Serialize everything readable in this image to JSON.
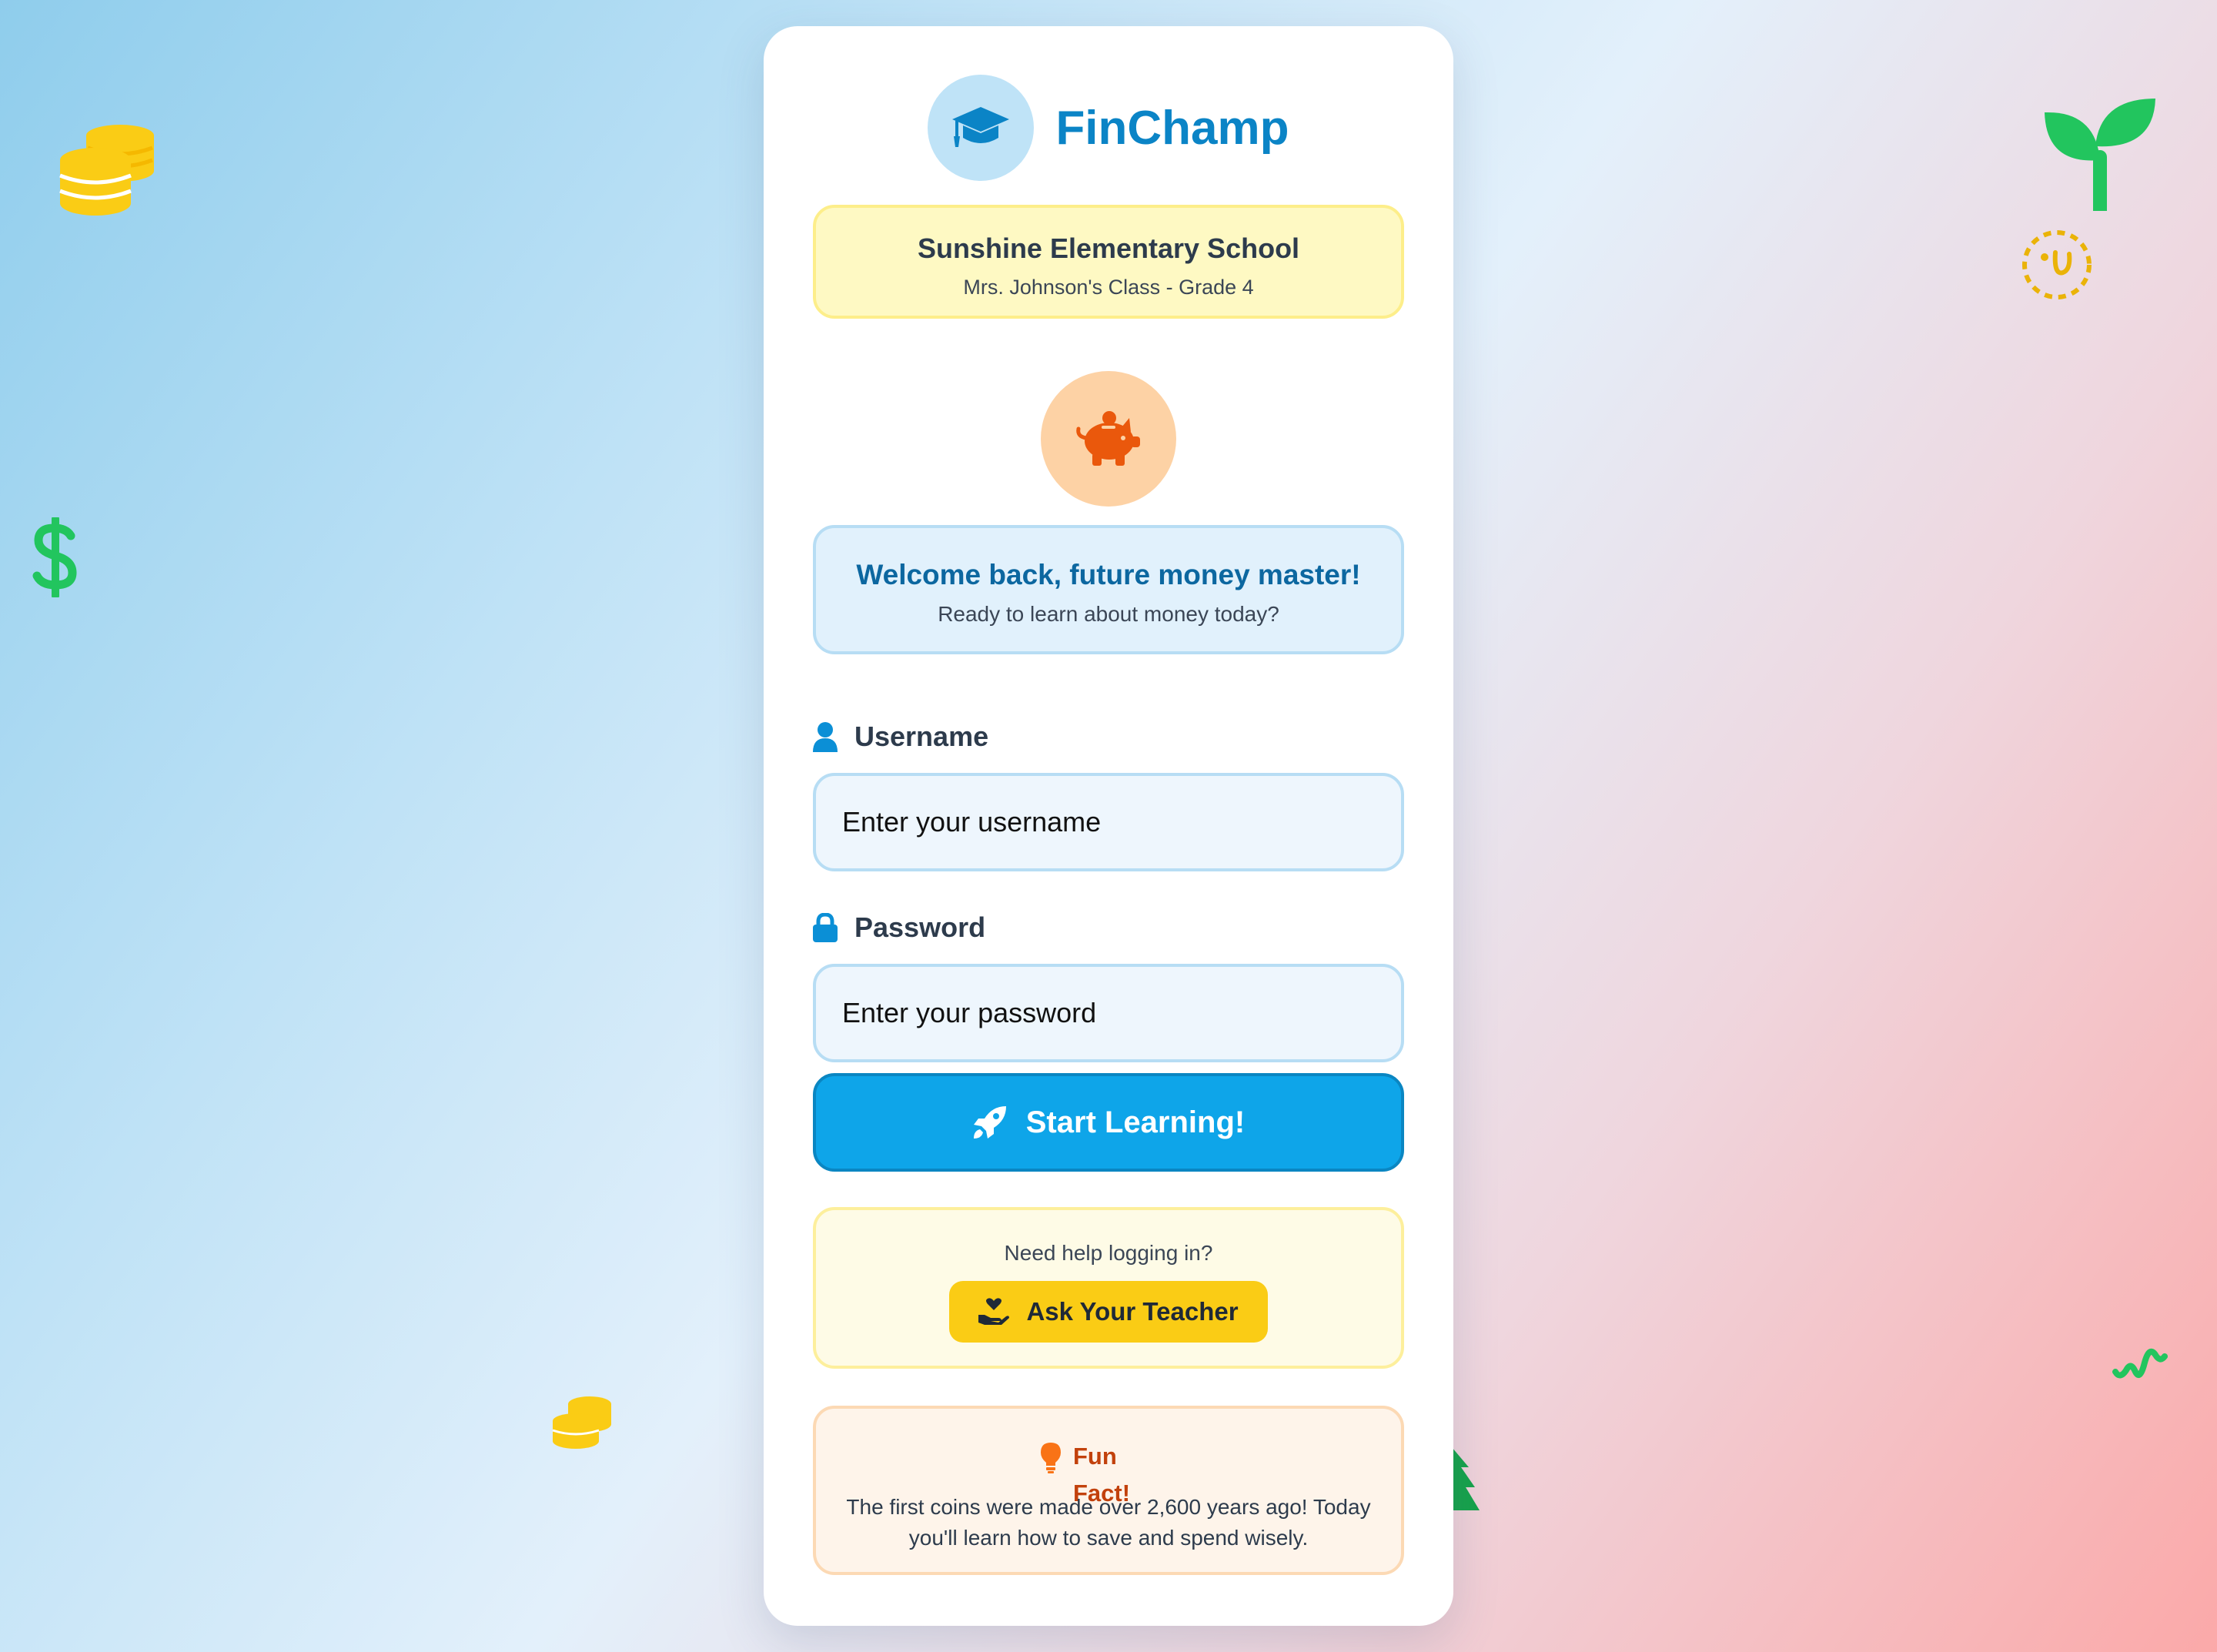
{
  "app": {
    "name": "FinChamp"
  },
  "school": {
    "name": "Sunshine Elementary School",
    "class": "Mrs. Johnson's Class - Grade 4"
  },
  "welcome": {
    "title": "Welcome back, future money master!",
    "subtitle": "Ready to learn about money today?"
  },
  "form": {
    "username_label": "Username",
    "username_placeholder": "Enter your username",
    "username_value": "",
    "password_label": "Password",
    "password_placeholder": "Enter your password",
    "password_value": "",
    "submit_label": "Start Learning!"
  },
  "help": {
    "question": "Need help logging in?",
    "button_label": "Ask Your Teacher"
  },
  "fun_fact": {
    "title": "Fun Fact!",
    "text": "The first coins were made over 2,600 years ago! Today you'll learn how to save and spend wisely."
  },
  "icons": {
    "logo": "graduation-cap-icon",
    "mascot": "piggy-bank-icon",
    "username": "user-icon",
    "password": "lock-icon",
    "submit": "rocket-icon",
    "help": "hand-holding-heart-icon",
    "fact": "lightbulb-icon"
  },
  "colors": {
    "primary": "#0ea5e9",
    "brand_text": "#0b84c6",
    "accent_yellow": "#facc15",
    "accent_orange": "#ea580c",
    "money_green": "#22c55e"
  }
}
